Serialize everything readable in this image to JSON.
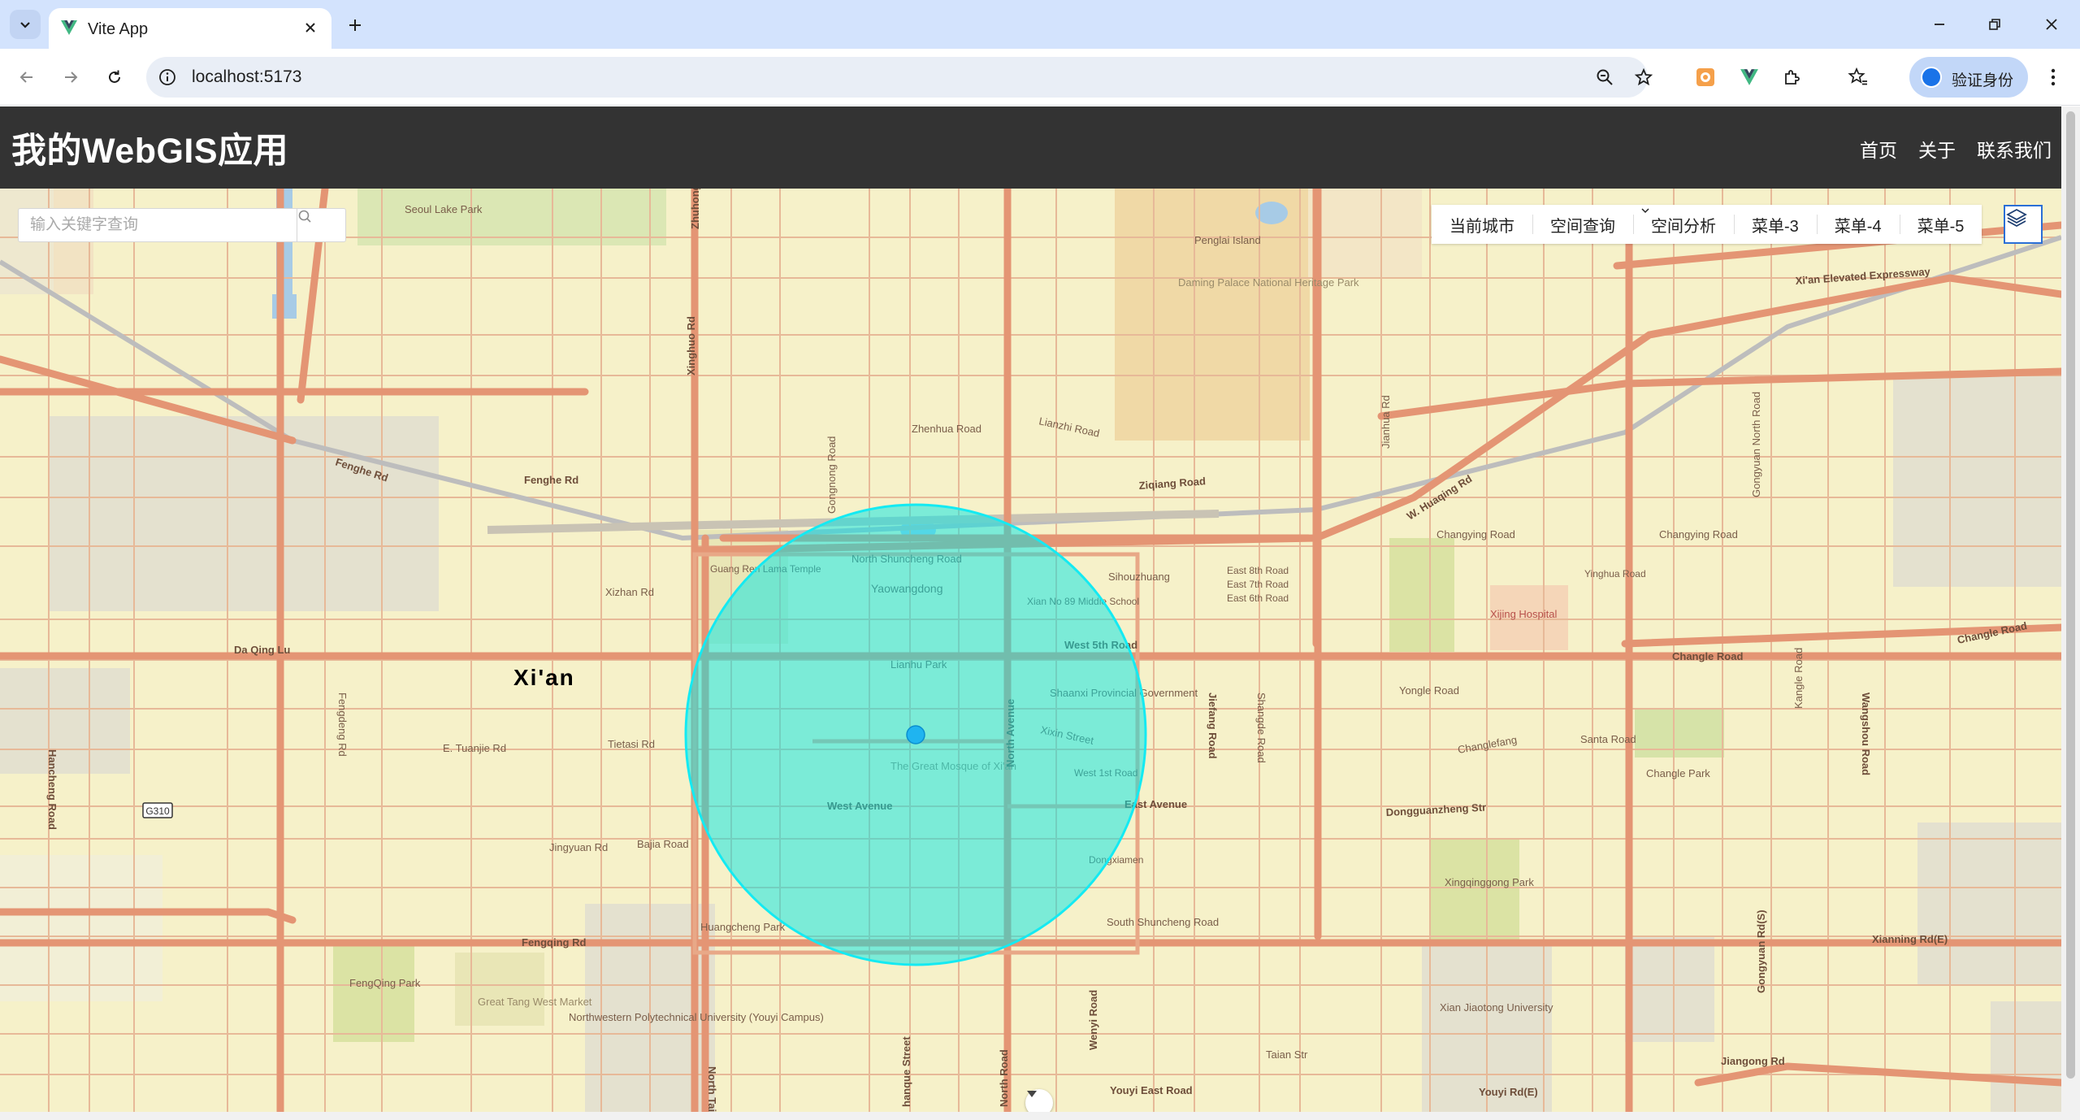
{
  "browser": {
    "tab_title": "Vite App",
    "url": "localhost:5173",
    "profile_label": "验证身份"
  },
  "app": {
    "title": "我的WebGIS应用",
    "nav": [
      "首页",
      "关于",
      "联系我们"
    ]
  },
  "search": {
    "placeholder": "输入关键字查询"
  },
  "map_menu": {
    "items": [
      "当前城市",
      "空间查询",
      "空间分析",
      "菜单-3",
      "菜单-4",
      "菜单-5"
    ]
  },
  "map": {
    "city_label": "Xi'an",
    "circle_color": "#00e5e5",
    "labels": {
      "seoul_lake_park": "Seoul Lake Park",
      "penglai_island": "Penglai Island",
      "daming_palace": "Daming Palace National Heritage Park",
      "elevated_expressway": "Xi'an Elevated Expressway",
      "zhuhong": "Zhuhong",
      "xinghuo": "Xinghuo Rd",
      "north_taibai": "North Taibai Rd",
      "gongnong": "Gongnong Road",
      "zhenhua": "Zhenhua Road",
      "lianzhi": "Lianzhi Road",
      "fenghe_rd_w": "Fenghe Rd",
      "fenghe_rd": "Fenghe Rd",
      "ziqiang": "Ziqiang Road",
      "w_huaqing": "W. Huaqing Rd",
      "changying": "Changying Road",
      "changying2": "Changying Road",
      "north_shuncheng": "North Shuncheng Road",
      "yaowangdong": "Yaowangdong",
      "guang_ren": "Guang Ren Lama Temple",
      "sihouzhuang": "Sihouzhuang",
      "east_8th": "East 8th Road",
      "east_7th": "East 7th Road",
      "east_6th": "East 6th Road",
      "xian_no89": "Xian No 89 Middle School",
      "xizhan": "Xizhan Rd",
      "da_qing": "Da Qing Lu",
      "west_5th": "West 5th Road",
      "lianhu_park": "Lianhu Park",
      "changle_road": "Changle Road",
      "changle_road2": "Changle Road",
      "xijing_hospital": "Xijing Hospital",
      "yinghua": "Yinghua Road",
      "shaanxi_gov": "Shaanxi Provincial Government",
      "yongle": "Yongle Road",
      "jiefang": "Jiefang Road",
      "e_tuanjie": "E. Tuanjie Rd",
      "tietasi": "Tietasi Rd",
      "xixin": "Xixin Street",
      "great_mosque": "The Great Mosque of Xi'an",
      "west_1st": "West 1st Road",
      "changlefang": "Changlefang",
      "santa": "Santa Road",
      "changle_park": "Changle Park",
      "west_avenue": "West Avenue",
      "east_avenue": "East Avenue",
      "north_avenue": "North Avenue",
      "dongguanzheng": "Dongguanzheng Str",
      "jingyuan": "Jingyuan Rd",
      "bajia": "Bajia Road",
      "dongxiamen": "Dongxiamen",
      "xingqinggong": "Xingqinggong Park",
      "huangcheng_park": "Huangcheng Park",
      "south_shuncheng": "South Shuncheng Road",
      "fengqing_rd": "Fengqing Rd",
      "xianning": "Xianning Rd(E)",
      "fengqing_park": "FengQing Park",
      "great_tang": "Great Tang West Market",
      "nwpu": "Northwestern Polytechnical University (Youyi Campus)",
      "xjtu": "Xian Jiaotong University",
      "youyi_east": "Youyi East Road",
      "youyi_e": "Youyi Rd(E)",
      "jiangong": "Jiangong Rd",
      "hancheng": "Hancheng Road",
      "g310": "G310",
      "wenyi": "Wenyi Road",
      "north_road": "North Road",
      "hanque": "hanque Street",
      "taian": "Taian Str",
      "gongyuan_north": "Gongyuan North Road",
      "wangshou": "Wangshou Road",
      "gongyuan_s": "Gongyuan Rd(S)",
      "jianhua": "Jianhua Rd",
      "fengdeng": "Fengdeng Rd",
      "shangde": "Shangde Road",
      "kangle": "Kangle Road"
    }
  }
}
